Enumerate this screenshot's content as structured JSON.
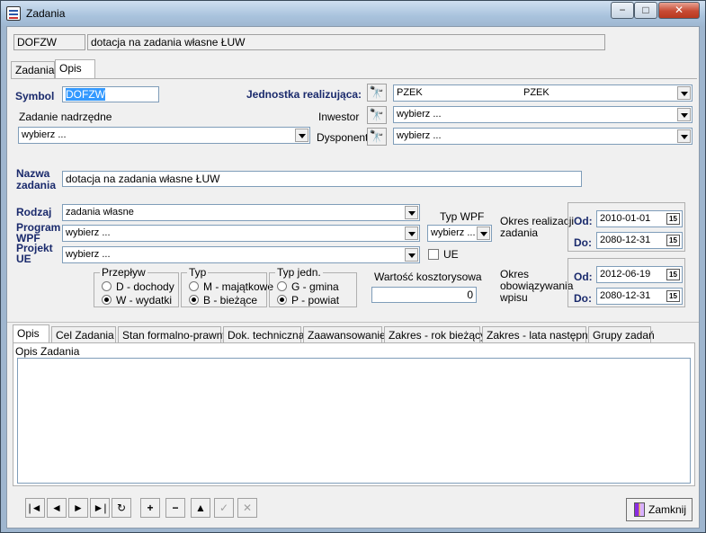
{
  "window": {
    "title": "Zadania"
  },
  "header": {
    "code": "DOFZW",
    "name": "dotacja na zadania własne ŁUW"
  },
  "top_tabs": [
    {
      "label": "Zadania"
    },
    {
      "label": "Opis"
    }
  ],
  "form": {
    "symbol_label": "Symbol",
    "symbol_value": "DOFZW",
    "jednostka_label": "Jednostka realizująca:",
    "jednostka_value": "PZEK",
    "jednostka_value2": "PZEK",
    "zadanie_nadrzedne_label": "Zadanie nadrzędne",
    "zadanie_nadrzedne_value": "wybierz ...",
    "inwestor_label": "Inwestor",
    "inwestor_value": "wybierz ...",
    "dysponent_label": "Dysponent",
    "dysponent_value": "wybierz ...",
    "nazwa_label_line1": "Nazwa",
    "nazwa_label_line2": "zadania",
    "nazwa_value": "dotacja na zadania własne ŁUW",
    "rodzaj_label": "Rodzaj",
    "rodzaj_value": "zadania własne",
    "program_label_line1": "Program",
    "program_label_line2": "WPF",
    "program_value": "wybierz ...",
    "projekt_label_line1": "Projekt",
    "projekt_label_line2": "UE",
    "projekt_value": "wybierz ...",
    "typ_wpf_label": "Typ WPF",
    "typ_wpf_value": "wybierz ...",
    "ue_label": "UE",
    "okres_realizacji_line1": "Okres realizacji",
    "okres_realizacji_line2": "zadania",
    "od_label": "Od:",
    "do_label": "Do:",
    "realizacja_od": "2010-01-01",
    "realizacja_do": "2080-12-31",
    "okres_obow_line1": "Okres",
    "okres_obow_line2": "obowiązywania",
    "okres_obow_line3": "wpisu",
    "obow_od": "2012-06-19",
    "obow_do": "2080-12-31",
    "wartosc_label": "Wartość kosztorysowa",
    "wartosc_value": "0",
    "calendar_icon_text": "15"
  },
  "groups": {
    "przeplyw": {
      "title": "Przepływ",
      "opt1": "D - dochody",
      "opt2": "W - wydatki"
    },
    "typ": {
      "title": "Typ",
      "opt1": "M - majątkowe",
      "opt2": "B - bieżące"
    },
    "typ_jedn": {
      "title": "Typ jedn.",
      "opt1": "G - gmina",
      "opt2": "P - powiat"
    }
  },
  "bottom_tabs": [
    {
      "label": "Opis"
    },
    {
      "label": "Cel Zadania"
    },
    {
      "label": "Stan formalno-prawny"
    },
    {
      "label": "Dok. techniczna"
    },
    {
      "label": "Zaawansowanie"
    },
    {
      "label": "Zakres - rok bieżący"
    },
    {
      "label": "Zakres - lata następne"
    },
    {
      "label": "Grupy zadań"
    }
  ],
  "opis_panel": {
    "label": "Opis Zadania",
    "value": ""
  },
  "toolbar": {
    "first": "|◄",
    "prev": "◄",
    "next": "►",
    "last": "►|",
    "refresh": "↻",
    "add": "+",
    "remove": "−",
    "edit": "▲",
    "confirm": "✓",
    "cancel": "✕"
  },
  "close_button": {
    "label": "Zamknij"
  }
}
